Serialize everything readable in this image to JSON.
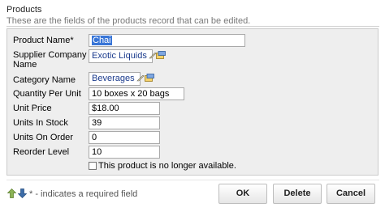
{
  "header": {
    "title": "Products",
    "description": "These are the fields of the products record that can be edited."
  },
  "form": {
    "product_name": {
      "label": "Product Name",
      "required_mark": "*",
      "value": "Chai"
    },
    "supplier": {
      "label_line1": "Supplier Company",
      "label_line2": "Name",
      "value": "Exotic Liquids"
    },
    "category": {
      "label": "Category Name",
      "value": "Beverages"
    },
    "quantity_per_unit": {
      "label": "Quantity Per Unit",
      "value": "10 boxes x 20 bags"
    },
    "unit_price": {
      "label": "Unit Price",
      "value": "$18.00"
    },
    "units_in_stock": {
      "label": "Units In Stock",
      "value": "39"
    },
    "units_on_order": {
      "label": "Units On Order",
      "value": "0"
    },
    "reorder_level": {
      "label": "Reorder Level",
      "value": "10"
    },
    "discontinued": {
      "label": "This product is no longer available.",
      "checked": false
    }
  },
  "footer": {
    "hint": "* - indicates a required field",
    "ok_label": "OK",
    "delete_label": "Delete",
    "cancel_label": "Cancel"
  },
  "icons": {
    "arrow_up": "arrow-up-icon",
    "arrow_down": "arrow-down-icon",
    "pencil": "pencil-icon",
    "lookup": "lookup-icon"
  },
  "colors": {
    "arrow_up": "#8bb356",
    "arrow_down": "#3c6ca8",
    "lookup_text": "#1a3a8c",
    "selection": "#3875d7"
  }
}
